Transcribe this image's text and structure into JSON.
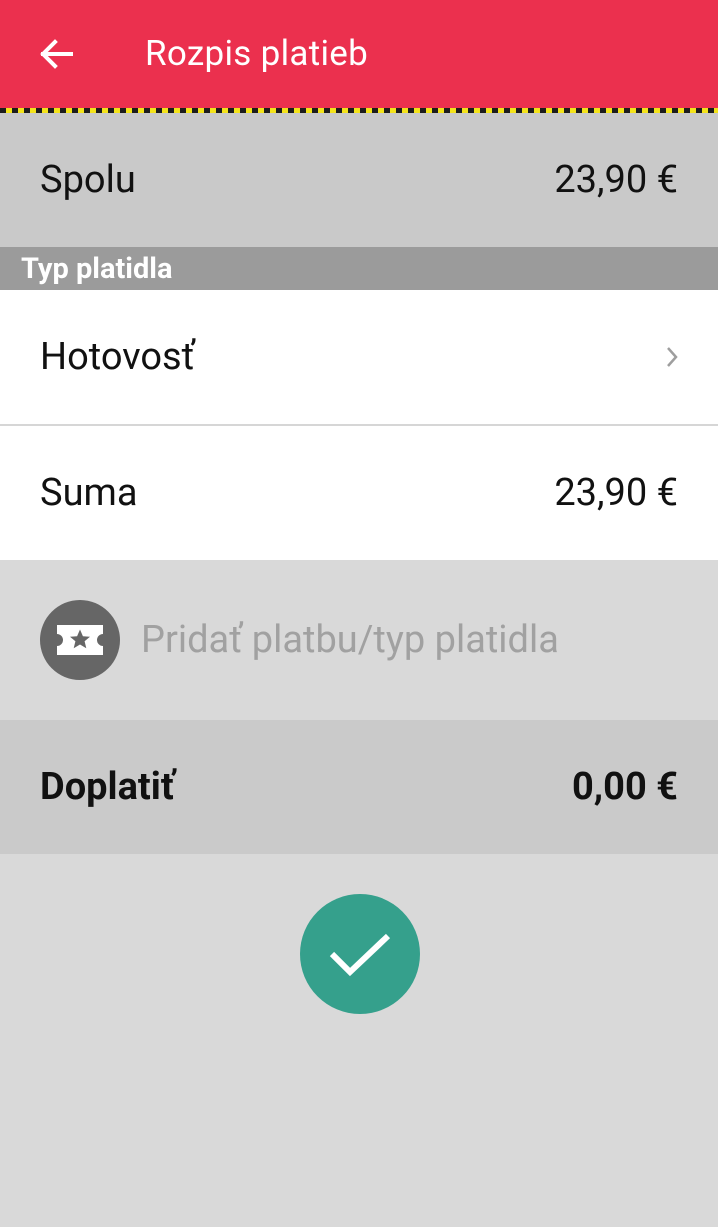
{
  "app_bar": {
    "title": "Rozpis platieb",
    "back_icon": "arrow-left-icon",
    "color": "#eb304e"
  },
  "total": {
    "label": "Spolu",
    "value": "23,90 €"
  },
  "section": {
    "header": "Typ platidla"
  },
  "payment_method": {
    "label": "Hotovosť",
    "icon": "chevron-right-icon"
  },
  "sum": {
    "label": "Suma",
    "value": "23,90 €"
  },
  "add_payment": {
    "label": "Pridať platbu/typ platidla",
    "icon": "ticket-star-icon"
  },
  "due": {
    "label": "Doplatiť",
    "value": "0,00 €"
  },
  "confirm": {
    "icon": "checkmark-icon",
    "color": "#35a08c"
  }
}
